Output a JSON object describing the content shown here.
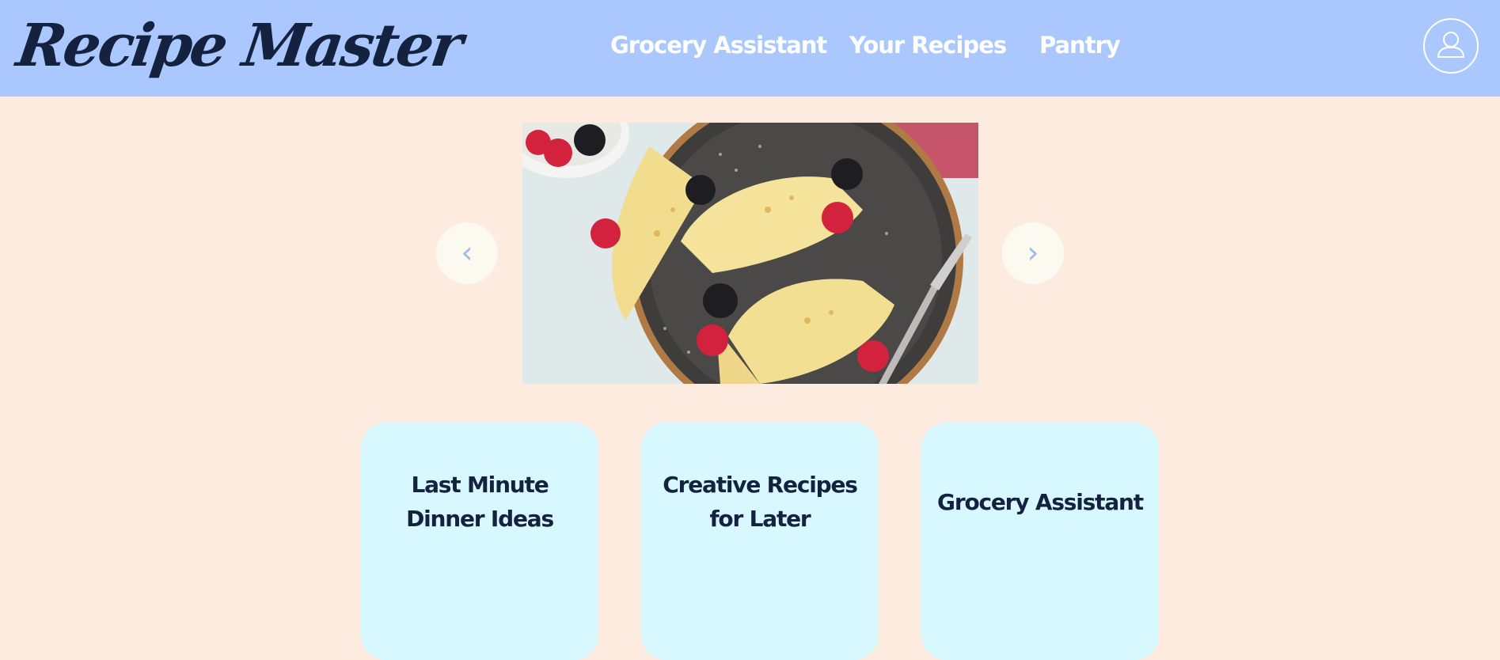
{
  "header": {
    "logo_text": "Recipe Master",
    "nav": [
      {
        "label": "Grocery Assistant"
      },
      {
        "label": "Your Recipes"
      },
      {
        "label": "Pantry"
      }
    ],
    "profile_icon": "user-icon"
  },
  "carousel": {
    "image_subject": "crepes with raspberries and blackberries on a dark plate",
    "prev_symbol": "‹",
    "next_symbol": "›"
  },
  "cards": [
    {
      "title": "Last Minute Dinner Ideas"
    },
    {
      "title": "Creative Recipes for Later"
    },
    {
      "title": "Grocery Assistant"
    }
  ],
  "colors": {
    "page_bg": "#fdebe0",
    "header_bg": "#abc8fe",
    "card_bg": "#d7f8ff",
    "text_dark": "#14223f",
    "arrow": "#9fb9f7"
  }
}
